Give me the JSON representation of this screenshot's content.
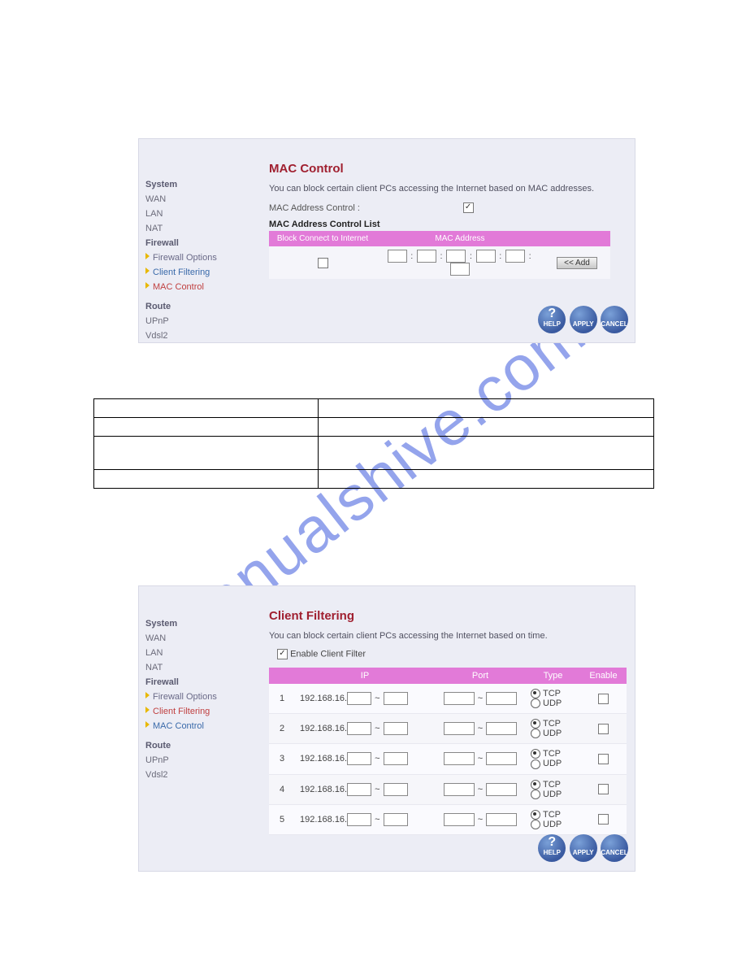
{
  "watermark": "manualshive.com",
  "nav": {
    "items": [
      "System",
      "WAN",
      "LAN",
      "NAT",
      "Firewall"
    ],
    "firewall_tree": {
      "options": "Firewall Options",
      "client_filtering": "Client Filtering",
      "mac_control": "MAC Control"
    },
    "tail": [
      "Route",
      "UPnP",
      "Vdsl2"
    ]
  },
  "mac": {
    "title": "MAC Control",
    "desc": "You can block certain client PCs accessing the Internet based on MAC addresses.",
    "label": "MAC Address Control :",
    "list_title": "MAC Address Control List",
    "cols": {
      "block": "Block Connect to Internet",
      "mac": "MAC Address"
    },
    "add": "<< Add"
  },
  "cf": {
    "title": "Client Filtering",
    "desc": "You can block certain client PCs accessing the Internet based on time.",
    "enable_label": "Enable Client Filter",
    "cols": {
      "ip": "IP",
      "port": "Port",
      "type": "Type",
      "enable": "Enable"
    },
    "ip_prefix": "192.168.16.",
    "tcp": "TCP",
    "udp": "UDP",
    "rows": [
      "1",
      "2",
      "3",
      "4",
      "5"
    ]
  },
  "buttons": {
    "help": "HELP",
    "apply": "APPLY",
    "cancel": "CANCEL"
  }
}
